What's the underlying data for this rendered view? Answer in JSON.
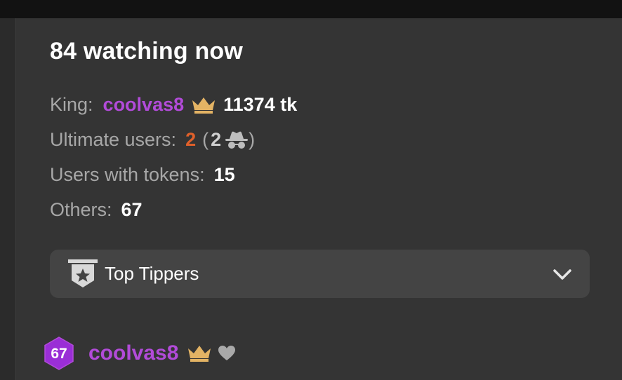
{
  "header": {
    "title": "84 watching now"
  },
  "stats": {
    "king_label": "King:",
    "king_name": "coolvas8",
    "king_tokens": "11374 tk",
    "ultimate_label": "Ultimate users:",
    "ultimate_count": "2",
    "ultimate_paren_open": "(",
    "ultimate_anon_count": "2",
    "ultimate_paren_close": ")",
    "tokens_label": "Users with tokens:",
    "tokens_count": "15",
    "others_label": "Others:",
    "others_count": "67"
  },
  "dropdown": {
    "label": "Top Tippers",
    "icon": "star-badge-icon",
    "chevron": "chevron-down-icon"
  },
  "user_list": [
    {
      "level": "67",
      "name": "coolvas8",
      "icons": [
        "crown-icon",
        "heart-icon"
      ]
    }
  ],
  "colors": {
    "background": "#343434",
    "username": "#b24bd9",
    "ultimate": "#e0602a",
    "crown": "#e3b364",
    "level_badge": "#9a2ed6"
  }
}
